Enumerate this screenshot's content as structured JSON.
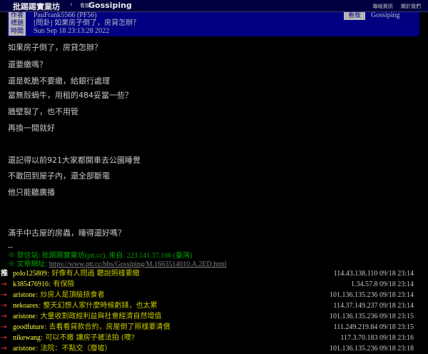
{
  "topbar": {
    "site_name": "批踢踢實業坊",
    "separator": "›",
    "board_prefix": "看板",
    "board_name": "Gossiping",
    "links": [
      "聯絡資訊",
      "關於我們"
    ]
  },
  "meta": {
    "author_label": "作者",
    "author_value": "PauFrank5566 (PF56)",
    "title_label": "標題",
    "title_value": "[問卦] 如果房子倒了，房貸怎辦？",
    "time_label": "時間",
    "time_value": "Sun Sep 18 23:13:28 2022",
    "board_label": "看板",
    "board_value": "Gossiping"
  },
  "content": {
    "lines": [
      "如果房子倒了，房貸怎辦？",
      "還要繳嗎？",
      "還是乾脆不要繳，給銀行處理",
      "當無殼蝸牛，用租的484妥當一些？",
      "牆壁裂了，也不用管",
      "再換一間就好",
      "還記得以前921大家都開車去公園睡覺",
      "不敢回到屋子內，還全部斷電",
      "他只能聽廣播",
      "滿手中古屋的房蟲，睡得還好嗎？"
    ]
  },
  "signature": {
    "dashes": "--",
    "line1": "※ 發信站: 批踢踢實業坊(ptt.cc), 來自: 223.141.37.166 (臺灣)",
    "line2_prefix": "※ 文章網址: ",
    "line2_url": "https://www.ptt.cc/bbs/Gossiping/M.1663514010.A.2ED.html"
  },
  "pushes": [
    {
      "tag": "推",
      "user": "polo125809",
      "msg": ": 好像有人問過 聽說照樣要繳",
      "ip": "114.43.138.110 09/18 23:14"
    },
    {
      "tag": "→",
      "user": "k385476916",
      "msg": ": 有保險",
      "ip": "1.34.57.8 09/18 23:14"
    },
    {
      "tag": "→",
      "user": "aristone",
      "msg": ": 炒房人是頂級掠食者",
      "ip": "101.136.135.236 09/18 23:14"
    },
    {
      "tag": "→",
      "user": "nekoares",
      "msg": ": 整天幻想人家什麼時候虧錢，也太累",
      "ip": "114.37.149.237 09/18 23:14"
    },
    {
      "tag": "→",
      "user": "aristone",
      "msg": ": 大量收割政經利益與社會經濟自然增值",
      "ip": "101.136.135.236 09/18 23:15"
    },
    {
      "tag": "→",
      "user": "goodfuture",
      "msg": ": 去看看貸款合約，房屋倒了照樣要清償",
      "ip": "111.249.219.84 09/18 23:15"
    },
    {
      "tag": "→",
      "user": "nikewang",
      "msg": ": 可以不繳 讓房子被法拍 (噢?",
      "ip": "117.3.70.183 09/18 23:16"
    },
    {
      "tag": "→",
      "user": "aristone",
      "msg": ": 法院：不點交（廢墟）",
      "ip": "101.136.135.236 09/18 23:18"
    }
  ]
}
